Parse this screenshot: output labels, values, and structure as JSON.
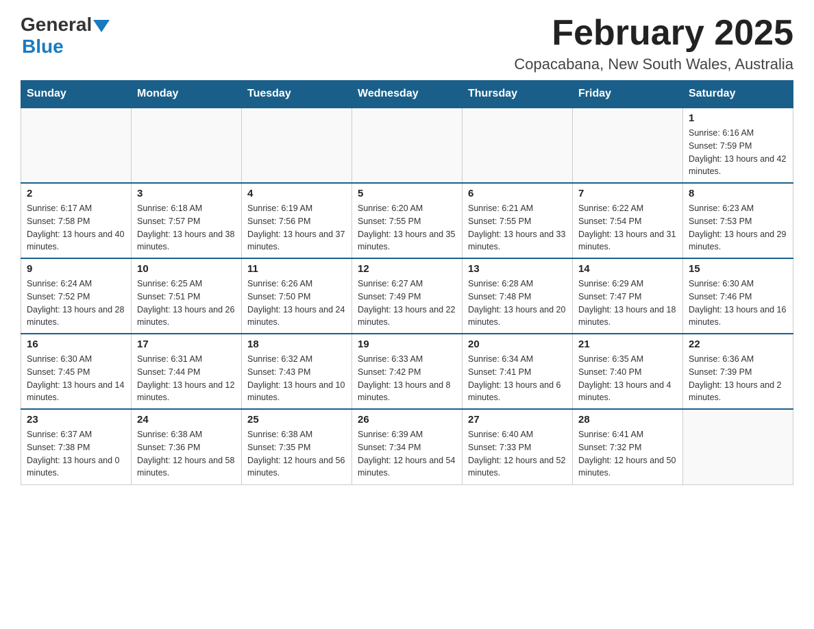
{
  "header": {
    "logo_general": "General",
    "logo_blue": "Blue",
    "month_title": "February 2025",
    "location": "Copacabana, New South Wales, Australia"
  },
  "weekdays": [
    "Sunday",
    "Monday",
    "Tuesday",
    "Wednesday",
    "Thursday",
    "Friday",
    "Saturday"
  ],
  "weeks": [
    [
      {
        "day": "",
        "sunrise": "",
        "sunset": "",
        "daylight": ""
      },
      {
        "day": "",
        "sunrise": "",
        "sunset": "",
        "daylight": ""
      },
      {
        "day": "",
        "sunrise": "",
        "sunset": "",
        "daylight": ""
      },
      {
        "day": "",
        "sunrise": "",
        "sunset": "",
        "daylight": ""
      },
      {
        "day": "",
        "sunrise": "",
        "sunset": "",
        "daylight": ""
      },
      {
        "day": "",
        "sunrise": "",
        "sunset": "",
        "daylight": ""
      },
      {
        "day": "1",
        "sunrise": "Sunrise: 6:16 AM",
        "sunset": "Sunset: 7:59 PM",
        "daylight": "Daylight: 13 hours and 42 minutes."
      }
    ],
    [
      {
        "day": "2",
        "sunrise": "Sunrise: 6:17 AM",
        "sunset": "Sunset: 7:58 PM",
        "daylight": "Daylight: 13 hours and 40 minutes."
      },
      {
        "day": "3",
        "sunrise": "Sunrise: 6:18 AM",
        "sunset": "Sunset: 7:57 PM",
        "daylight": "Daylight: 13 hours and 38 minutes."
      },
      {
        "day": "4",
        "sunrise": "Sunrise: 6:19 AM",
        "sunset": "Sunset: 7:56 PM",
        "daylight": "Daylight: 13 hours and 37 minutes."
      },
      {
        "day": "5",
        "sunrise": "Sunrise: 6:20 AM",
        "sunset": "Sunset: 7:55 PM",
        "daylight": "Daylight: 13 hours and 35 minutes."
      },
      {
        "day": "6",
        "sunrise": "Sunrise: 6:21 AM",
        "sunset": "Sunset: 7:55 PM",
        "daylight": "Daylight: 13 hours and 33 minutes."
      },
      {
        "day": "7",
        "sunrise": "Sunrise: 6:22 AM",
        "sunset": "Sunset: 7:54 PM",
        "daylight": "Daylight: 13 hours and 31 minutes."
      },
      {
        "day": "8",
        "sunrise": "Sunrise: 6:23 AM",
        "sunset": "Sunset: 7:53 PM",
        "daylight": "Daylight: 13 hours and 29 minutes."
      }
    ],
    [
      {
        "day": "9",
        "sunrise": "Sunrise: 6:24 AM",
        "sunset": "Sunset: 7:52 PM",
        "daylight": "Daylight: 13 hours and 28 minutes."
      },
      {
        "day": "10",
        "sunrise": "Sunrise: 6:25 AM",
        "sunset": "Sunset: 7:51 PM",
        "daylight": "Daylight: 13 hours and 26 minutes."
      },
      {
        "day": "11",
        "sunrise": "Sunrise: 6:26 AM",
        "sunset": "Sunset: 7:50 PM",
        "daylight": "Daylight: 13 hours and 24 minutes."
      },
      {
        "day": "12",
        "sunrise": "Sunrise: 6:27 AM",
        "sunset": "Sunset: 7:49 PM",
        "daylight": "Daylight: 13 hours and 22 minutes."
      },
      {
        "day": "13",
        "sunrise": "Sunrise: 6:28 AM",
        "sunset": "Sunset: 7:48 PM",
        "daylight": "Daylight: 13 hours and 20 minutes."
      },
      {
        "day": "14",
        "sunrise": "Sunrise: 6:29 AM",
        "sunset": "Sunset: 7:47 PM",
        "daylight": "Daylight: 13 hours and 18 minutes."
      },
      {
        "day": "15",
        "sunrise": "Sunrise: 6:30 AM",
        "sunset": "Sunset: 7:46 PM",
        "daylight": "Daylight: 13 hours and 16 minutes."
      }
    ],
    [
      {
        "day": "16",
        "sunrise": "Sunrise: 6:30 AM",
        "sunset": "Sunset: 7:45 PM",
        "daylight": "Daylight: 13 hours and 14 minutes."
      },
      {
        "day": "17",
        "sunrise": "Sunrise: 6:31 AM",
        "sunset": "Sunset: 7:44 PM",
        "daylight": "Daylight: 13 hours and 12 minutes."
      },
      {
        "day": "18",
        "sunrise": "Sunrise: 6:32 AM",
        "sunset": "Sunset: 7:43 PM",
        "daylight": "Daylight: 13 hours and 10 minutes."
      },
      {
        "day": "19",
        "sunrise": "Sunrise: 6:33 AM",
        "sunset": "Sunset: 7:42 PM",
        "daylight": "Daylight: 13 hours and 8 minutes."
      },
      {
        "day": "20",
        "sunrise": "Sunrise: 6:34 AM",
        "sunset": "Sunset: 7:41 PM",
        "daylight": "Daylight: 13 hours and 6 minutes."
      },
      {
        "day": "21",
        "sunrise": "Sunrise: 6:35 AM",
        "sunset": "Sunset: 7:40 PM",
        "daylight": "Daylight: 13 hours and 4 minutes."
      },
      {
        "day": "22",
        "sunrise": "Sunrise: 6:36 AM",
        "sunset": "Sunset: 7:39 PM",
        "daylight": "Daylight: 13 hours and 2 minutes."
      }
    ],
    [
      {
        "day": "23",
        "sunrise": "Sunrise: 6:37 AM",
        "sunset": "Sunset: 7:38 PM",
        "daylight": "Daylight: 13 hours and 0 minutes."
      },
      {
        "day": "24",
        "sunrise": "Sunrise: 6:38 AM",
        "sunset": "Sunset: 7:36 PM",
        "daylight": "Daylight: 12 hours and 58 minutes."
      },
      {
        "day": "25",
        "sunrise": "Sunrise: 6:38 AM",
        "sunset": "Sunset: 7:35 PM",
        "daylight": "Daylight: 12 hours and 56 minutes."
      },
      {
        "day": "26",
        "sunrise": "Sunrise: 6:39 AM",
        "sunset": "Sunset: 7:34 PM",
        "daylight": "Daylight: 12 hours and 54 minutes."
      },
      {
        "day": "27",
        "sunrise": "Sunrise: 6:40 AM",
        "sunset": "Sunset: 7:33 PM",
        "daylight": "Daylight: 12 hours and 52 minutes."
      },
      {
        "day": "28",
        "sunrise": "Sunrise: 6:41 AM",
        "sunset": "Sunset: 7:32 PM",
        "daylight": "Daylight: 12 hours and 50 minutes."
      },
      {
        "day": "",
        "sunrise": "",
        "sunset": "",
        "daylight": ""
      }
    ]
  ]
}
